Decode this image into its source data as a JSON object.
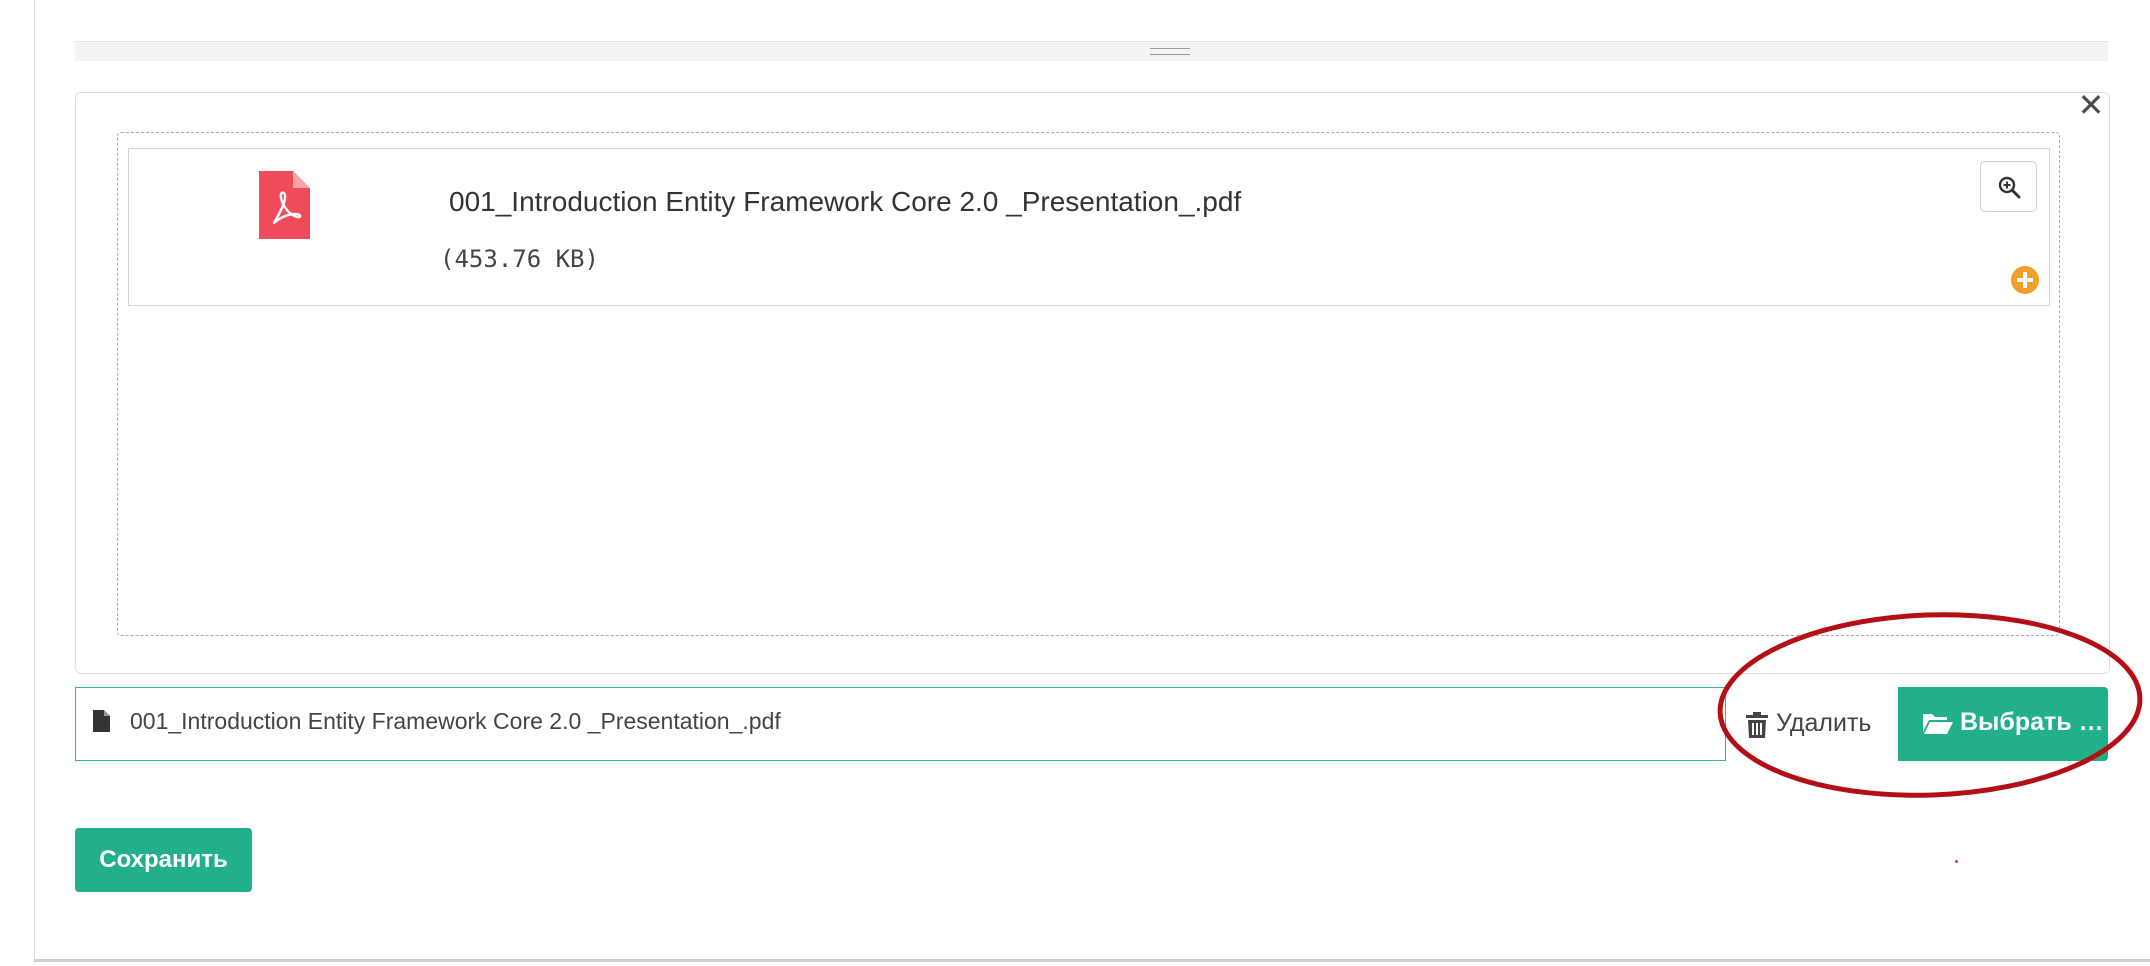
{
  "preview": {
    "file_name": "001_Introduction Entity Framework Core 2.0 _Presentation_.pdf",
    "file_size": "(453.76 KB)",
    "close_glyph": "✕"
  },
  "input": {
    "selected_file": "001_Introduction Entity Framework Core 2.0 _Presentation_.pdf"
  },
  "actions": {
    "remove_label": "Удалить",
    "browse_label": "Выбрать …",
    "save_label": "Сохранить"
  },
  "colors": {
    "accent": "#22b08b",
    "pdf_icon": "#ee4c5b",
    "add_icon": "#f0a02b",
    "annotation": "#b50f16"
  },
  "icons": {
    "pdf": "pdf-file-icon",
    "zoom": "zoom-in-icon",
    "add": "plus-circle-icon",
    "file": "file-icon",
    "trash": "trash-icon",
    "folder": "folder-open-icon",
    "close": "close-icon"
  }
}
